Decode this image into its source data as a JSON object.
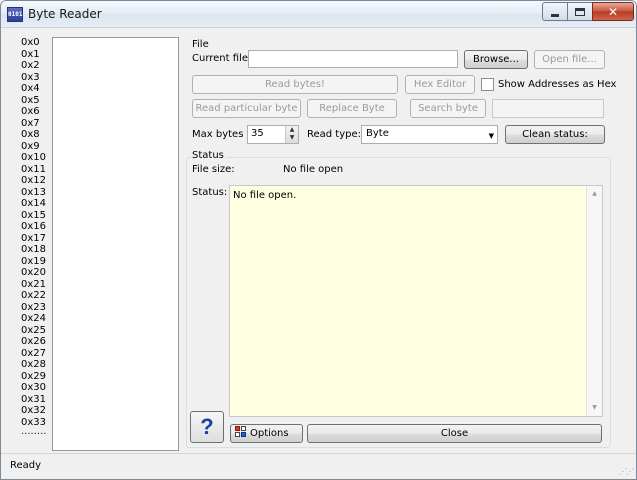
{
  "window": {
    "title": "Byte Reader",
    "icon": "app-icon"
  },
  "address_list": {
    "items": [
      "0x0",
      "0x1",
      "0x2",
      "0x3",
      "0x4",
      "0x5",
      "0x6",
      "0x7",
      "0x8",
      "0x9",
      "0x10",
      "0x11",
      "0x12",
      "0x13",
      "0x14",
      "0x15",
      "0x16",
      "0x17",
      "0x18",
      "0x19",
      "0x20",
      "0x21",
      "0x22",
      "0x23",
      "0x24",
      "0x25",
      "0x26",
      "0x27",
      "0x28",
      "0x29",
      "0x30",
      "0x31",
      "0x32",
      "0x33"
    ],
    "more": "........"
  },
  "file_group": {
    "title": "File",
    "current_file_label": "Current file:",
    "current_file_value": "",
    "browse_label": "Browse...",
    "open_file_label": "Open file...",
    "read_bytes_label": "Read bytes!",
    "hex_editor_label": "Hex Editor",
    "show_addresses_hex_label": "Show Addresses as Hex",
    "show_addresses_hex_checked": false,
    "read_particular_label": "Read particular byte",
    "replace_byte_label": "Replace Byte",
    "search_byte_label": "Search byte",
    "search_value": "",
    "max_bytes_label": "Max bytes",
    "max_bytes_value": "35",
    "read_type_label": "Read type:",
    "read_type_value": "Byte",
    "clean_status_label": "Clean status:"
  },
  "status_group": {
    "title": "Status",
    "file_size_label": "File size:",
    "file_size_value": "No file open",
    "status_label": "Status:",
    "status_text": "No file open."
  },
  "bottom": {
    "help_label": "?",
    "options_label": "Options",
    "close_label": "Close"
  },
  "statusbar": {
    "text": "Ready"
  }
}
